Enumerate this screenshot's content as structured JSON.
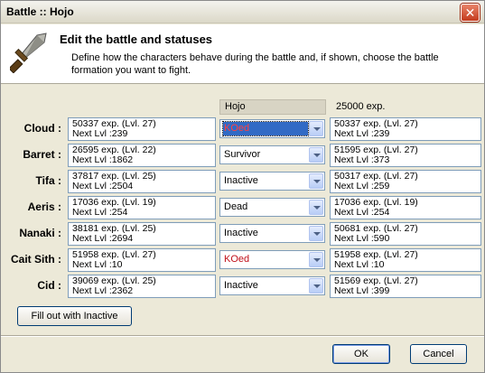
{
  "window": {
    "title": "Battle :: Hojo",
    "close_glyph": "✕"
  },
  "header": {
    "icon": "sword-icon",
    "title": "Edit the battle and statuses",
    "description": "Define how the characters behave during the battle and, if shown, choose the battle formation you want to fight."
  },
  "columns": {
    "battle_name": "Hojo",
    "exp_reward": "25000 exp."
  },
  "characters": [
    {
      "name": "Cloud :",
      "before_exp": "50337 exp. (Lvl. 27)",
      "before_next": "Next Lvl :239",
      "status": "KOed",
      "after_exp": "50337 exp. (Lvl. 27)",
      "after_next": "Next Lvl :239"
    },
    {
      "name": "Barret :",
      "before_exp": "26595 exp. (Lvl. 22)",
      "before_next": "Next Lvl :1862",
      "status": "Survivor",
      "after_exp": "51595 exp. (Lvl. 27)",
      "after_next": "Next Lvl :373"
    },
    {
      "name": "Tifa :",
      "before_exp": "37817 exp. (Lvl. 25)",
      "before_next": "Next Lvl :2504",
      "status": "Inactive",
      "after_exp": "50317 exp. (Lvl. 27)",
      "after_next": "Next Lvl :259"
    },
    {
      "name": "Aeris :",
      "before_exp": "17036 exp. (Lvl. 19)",
      "before_next": "Next Lvl :254",
      "status": "Dead",
      "after_exp": "17036 exp. (Lvl. 19)",
      "after_next": "Next Lvl :254"
    },
    {
      "name": "Nanaki :",
      "before_exp": "38181 exp. (Lvl. 25)",
      "before_next": "Next Lvl :2694",
      "status": "Inactive",
      "after_exp": "50681 exp. (Lvl. 27)",
      "after_next": "Next Lvl :590"
    },
    {
      "name": "Cait Sith :",
      "before_exp": "51958 exp. (Lvl. 27)",
      "before_next": "Next Lvl :10",
      "status": "KOed",
      "after_exp": "51958 exp. (Lvl. 27)",
      "after_next": "Next Lvl :10"
    },
    {
      "name": "Cid :",
      "before_exp": "39069 exp. (Lvl. 25)",
      "before_next": "Next Lvl :2362",
      "status": "Inactive",
      "after_exp": "51569 exp. (Lvl. 27)",
      "after_next": "Next Lvl :399"
    }
  ],
  "buttons": {
    "fill_inactive": "Fill out with Inactive",
    "ok": "OK",
    "cancel": "Cancel"
  },
  "colors": {
    "koed_text": "#c0101a",
    "selection": "#316ac5"
  }
}
